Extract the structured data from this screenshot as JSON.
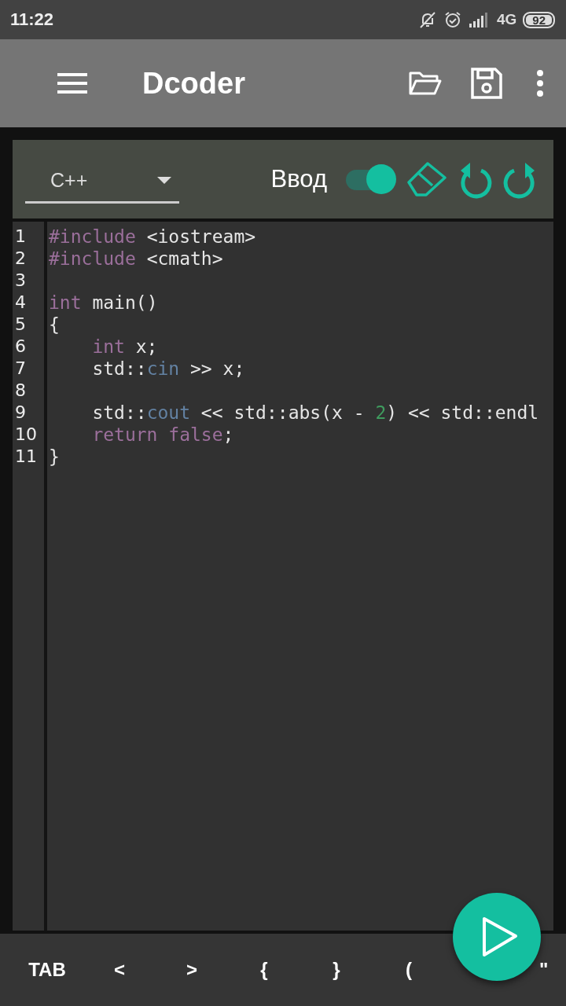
{
  "status_bar": {
    "time": "11:22",
    "network": "4G",
    "battery": "92"
  },
  "app_bar": {
    "title": "Dcoder"
  },
  "editor_toolbar": {
    "language": "C++",
    "input_label": "Ввод",
    "input_on": true
  },
  "code": [
    {
      "kind": "code",
      "indented": false,
      "tokens": [
        {
          "kind": "keyword",
          "text": "#include"
        },
        {
          "kind": "plain",
          "text": " <iostream>"
        }
      ]
    },
    {
      "kind": "code",
      "indented": false,
      "tokens": [
        {
          "kind": "keyword",
          "text": "#include"
        },
        {
          "kind": "plain",
          "text": " <cmath>"
        }
      ]
    },
    {
      "kind": "blank"
    },
    {
      "kind": "code",
      "indented": false,
      "tokens": [
        {
          "kind": "keyword",
          "text": "int"
        },
        {
          "kind": "plain",
          "text": " main()"
        }
      ]
    },
    {
      "kind": "code",
      "indented": false,
      "tokens": [
        {
          "kind": "plain",
          "text": "{"
        }
      ]
    },
    {
      "kind": "code",
      "indented": true,
      "tokens": [
        {
          "kind": "keyword",
          "text": "int"
        },
        {
          "kind": "plain",
          "text": " x;"
        }
      ]
    },
    {
      "kind": "code",
      "indented": true,
      "tokens": [
        {
          "kind": "plain",
          "text": "std::"
        },
        {
          "kind": "builtin",
          "text": "cin"
        },
        {
          "kind": "plain",
          "text": " >> x;"
        }
      ]
    },
    {
      "kind": "blank"
    },
    {
      "kind": "code",
      "indented": true,
      "tokens": [
        {
          "kind": "plain",
          "text": "std::"
        },
        {
          "kind": "builtin",
          "text": "cout"
        },
        {
          "kind": "plain",
          "text": " << std::abs(x - "
        },
        {
          "kind": "number",
          "text": "2"
        },
        {
          "kind": "plain",
          "text": ") << std::endl"
        }
      ]
    },
    {
      "kind": "code",
      "indented": true,
      "tokens": [
        {
          "kind": "keyword",
          "text": "return false"
        },
        {
          "kind": "plain",
          "text": ";"
        }
      ]
    },
    {
      "kind": "code",
      "indented": false,
      "tokens": [
        {
          "kind": "plain",
          "text": "}"
        }
      ]
    }
  ],
  "line_numbers": [
    "1",
    "2",
    "3",
    "4",
    "5",
    "6",
    "7",
    "8",
    "9",
    "10",
    "11"
  ],
  "keys": [
    "TAB",
    "<",
    ">",
    "{",
    "}",
    "(",
    "\""
  ]
}
